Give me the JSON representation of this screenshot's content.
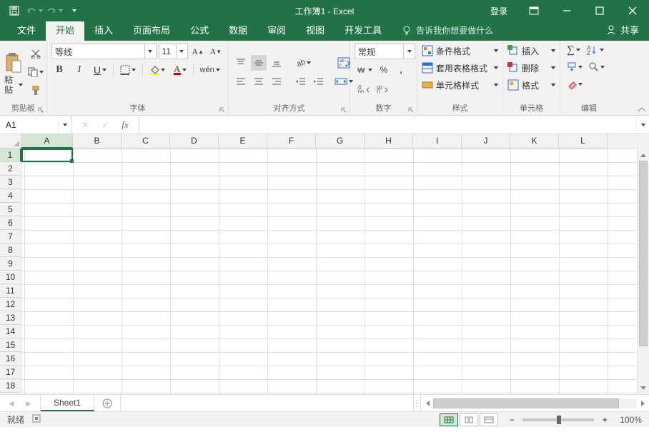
{
  "title": {
    "doc": "工作簿1",
    "app": "Excel",
    "full": "工作簿1  -  Excel",
    "login": "登录",
    "share": "共享"
  },
  "tabs": {
    "file": "文件",
    "home": "开始",
    "insert": "插入",
    "pagelayout": "页面布局",
    "formulas": "公式",
    "data": "数据",
    "review": "审阅",
    "view": "视图",
    "developer": "开发工具",
    "tellme": "告诉我你想要做什么"
  },
  "ribbon": {
    "clipboard": {
      "label": "剪贴板",
      "paste": "粘贴"
    },
    "font": {
      "label": "字体",
      "name": "等线",
      "size": "11",
      "bold": "B",
      "italic": "I",
      "underline": "U",
      "phonetic": "wén"
    },
    "alignment": {
      "label": "对齐方式"
    },
    "number": {
      "label": "数字",
      "format": "常规"
    },
    "styles": {
      "label": "样式",
      "conditional": "条件格式",
      "tableformat": "套用表格格式",
      "cellstyles": "单元格样式"
    },
    "cells": {
      "label": "单元格",
      "insert": "插入",
      "delete": "删除",
      "format": "格式"
    },
    "editing": {
      "label": "编辑"
    }
  },
  "formula_bar": {
    "cell_ref": "A1",
    "formula": ""
  },
  "columns": [
    "A",
    "B",
    "C",
    "D",
    "E",
    "F",
    "G",
    "H",
    "I",
    "J",
    "K",
    "L"
  ],
  "rows": [
    1,
    2,
    3,
    4,
    5,
    6,
    7,
    8,
    9,
    10,
    11,
    12,
    13,
    14,
    15,
    16,
    17,
    18
  ],
  "sheets": {
    "tab1": "Sheet1"
  },
  "status": {
    "ready": "就绪",
    "zoom": "100%"
  }
}
